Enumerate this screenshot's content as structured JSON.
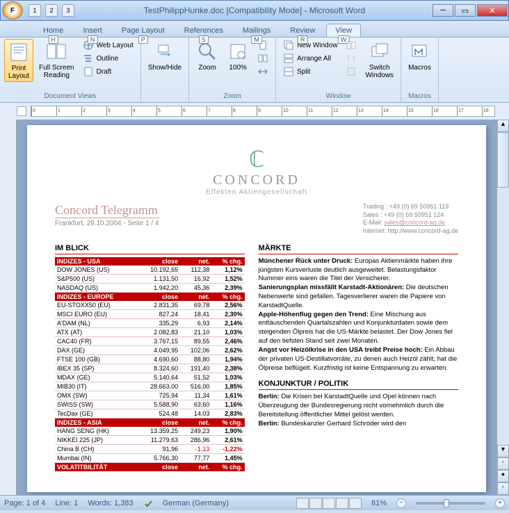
{
  "window": {
    "title": "TestPhilippHunke.doc [Compatibility Mode] - Microsoft Word",
    "qat": [
      "1",
      "2",
      "3"
    ],
    "office_key": "F"
  },
  "tabs": {
    "items": [
      {
        "label": "Home",
        "key": "H"
      },
      {
        "label": "Insert",
        "key": "N"
      },
      {
        "label": "Page Layout",
        "key": "P"
      },
      {
        "label": "References",
        "key": "S"
      },
      {
        "label": "Mailings",
        "key": "M"
      },
      {
        "label": "Review",
        "key": "R"
      },
      {
        "label": "View",
        "key": "W"
      }
    ],
    "active": 6
  },
  "ribbon": {
    "groups": {
      "doc_views": {
        "label": "Document Views",
        "print_layout": "Print\nLayout",
        "full_screen": "Full Screen\nReading",
        "web_layout": "Web Layout",
        "outline": "Outline",
        "draft": "Draft"
      },
      "showhide": {
        "label": "Show/Hide"
      },
      "zoom": {
        "label": "Zoom",
        "zoom": "Zoom",
        "hundred": "100%"
      },
      "window": {
        "label": "Window",
        "new_window": "New Window",
        "arrange_all": "Arrange All",
        "split": "Split",
        "switch": "Switch\nWindows"
      },
      "macros": {
        "label": "Macros",
        "macros": "Macros"
      }
    }
  },
  "document": {
    "logo_name": "CONCORD",
    "logo_sub": "Effekten Aktiengesellschaft",
    "title": "Concord Telegramm",
    "subtitle": "Frankfurt, 29.10.2004 - Seite 1 / 4",
    "contact": {
      "trading": "Trading : +49 (0) 69 50951 119",
      "sales": "Sales : +49 (0) 69 50951 124",
      "email_lbl": "E-Mail: ",
      "email": "sales@concord-ag.de",
      "internet": "Internet: http://www.concord-ag.de"
    },
    "left_head": "IM BLICK",
    "headers": {
      "usa": "INDIZES - USA",
      "europe": "INDIZES - EUROPE",
      "asia": "INDIZES - ASIA",
      "vol": "VOLATITBILITÄT",
      "close": "close",
      "net": "net.",
      "chg": "% chg."
    },
    "indices": {
      "usa": [
        {
          "n": "DOW JONES (US)",
          "c": "10.192,65",
          "net": "112,38",
          "chg": "1,12%"
        },
        {
          "n": "S&P500 (US)",
          "c": "1.131,50",
          "net": "16,92",
          "chg": "1,52%"
        },
        {
          "n": "NASDAQ (US)",
          "c": "1.942,20",
          "net": "45,36",
          "chg": "2,39%"
        }
      ],
      "europe": [
        {
          "n": "EU-STOXX50 (EU)",
          "c": "2.831,35",
          "net": "69,78",
          "chg": "2,56%"
        },
        {
          "n": "MSCI EURO (EU)",
          "c": "827,24",
          "net": "18,41",
          "chg": "2,30%"
        },
        {
          "n": "A'DAM (NL)",
          "c": "335,29",
          "net": "6,93",
          "chg": "2,14%"
        },
        {
          "n": "ATX (AT)",
          "c": "2.082,83",
          "net": "21,10",
          "chg": "1,03%"
        },
        {
          "n": "CAC40 (FR)",
          "c": "3.767,15",
          "net": "89,55",
          "chg": "2,46%"
        },
        {
          "n": "DAX (GE)",
          "c": "4.049,95",
          "net": "102,06",
          "chg": "2,62%"
        },
        {
          "n": "FTSE 100 (GB)",
          "c": "4.690,60",
          "net": "88,80",
          "chg": "1,94%"
        },
        {
          "n": "IBEX 35 (SP)",
          "c": "8.324,60",
          "net": "191,40",
          "chg": "2,38%"
        },
        {
          "n": "MDAX (GE)",
          "c": "5.140,64",
          "net": "51,52",
          "chg": "1,03%"
        },
        {
          "n": "MIB30 (IT)",
          "c": "28.663,00",
          "net": "516,00",
          "chg": "1,85%"
        },
        {
          "n": "OMX (SW)",
          "c": "725,94",
          "net": "11,34",
          "chg": "1,61%"
        },
        {
          "n": "SWISS (SW)",
          "c": "5.588,90",
          "net": "63,60",
          "chg": "1,16%"
        },
        {
          "n": "TecDax (GE)",
          "c": "524,48",
          "net": "14,03",
          "chg": "2,83%"
        }
      ],
      "asia": [
        {
          "n": "HANG SENG (HK)",
          "c": "13.359,25",
          "net": "249,23",
          "chg": "1,90%"
        },
        {
          "n": "NIKKEI 225 (JP)",
          "c": "11.279,63",
          "net": "286,96",
          "chg": "2,61%"
        },
        {
          "n": "China B (CH)",
          "c": "91,96",
          "net": "-1,13",
          "chg": "-1,22%",
          "neg": true
        },
        {
          "n": "Mumbai (IN)",
          "c": "5.766,30",
          "net": "77,77",
          "chg": "1,45%"
        }
      ]
    },
    "markte_head": "MÄRKTE",
    "markte": [
      {
        "b": "Münchener Rück unter Druck:",
        "t": " Europas Aktienmärkte haben ihre jüngsten Kursverluste deutlich ausgeweitet. Belastungsfaktor Nummer eins waren die Titel der Versicherer."
      },
      {
        "b": "Sanierungsplan missfällt Karstadt-Aktionären:",
        "t": " Die deutschen Nebenwerte sind gefallen. Tagesverlierer waren die Papiere von KarstadtQuelle."
      },
      {
        "b": "Apple-Höhenflug gegen den Trend:",
        "t": " Eine Mischung aus enttäuschenden Quartalszahlen und Konjunkturdaten sowie dem steigenden Ölpreis hat die US-Märkte belastet. Der Dow Jones fiel auf den tiefsten Stand seit zwei Monaten."
      },
      {
        "b": "Angst vor Heizölkrise in den USA treibt Preise hoch:",
        "t": " Ein Abbau der privaten US-Destillatvorräte, zu denen auch Heizöl zählt, hat die Ölpreise beflügelt. Kurzfristig ist keine Entspannung zu erwarten."
      }
    ],
    "konj_head": "KONJUNKTUR / POLITIK",
    "konj": [
      {
        "b": "Berlin:",
        "t": " Die Krisen bei KarstadtQuelle und Opel können nach Überzeugung der Bundesregierung nicht vornehmlich durch die Bereitstellung öffentlicher Mittel gelöst werden."
      },
      {
        "b": "Berlin:",
        "t": " Bundeskanzler Gerhard Schröder wird den"
      }
    ]
  },
  "status": {
    "page": "Page: 1 of 4",
    "line": "Line: 1",
    "words": "Words: 1,383",
    "lang": "German (Germany)",
    "zoom": "81%"
  }
}
